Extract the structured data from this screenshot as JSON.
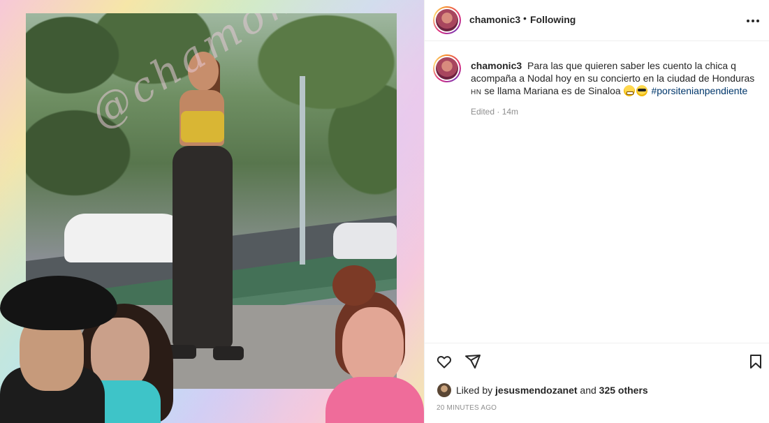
{
  "post": {
    "username": "chamonic3",
    "separator": "•",
    "follow_status": "Following",
    "caption": {
      "username": "chamonic3",
      "text_part1": "Para las que quieren saber les cuento la chica q acompaña a Nodal hoy en su concierto en la ciudad de Honduras",
      "flag": "HN",
      "text_part2": "se llama Mariana es de Sinaloa",
      "hashtag": "#porsitenianpendiente"
    },
    "edited": "Edited · 14m",
    "likes": {
      "prefix": "Liked by",
      "user": "jesusmendozanet",
      "and": "and",
      "others": "325 others"
    },
    "timestamp": "20 minutes ago"
  },
  "media": {
    "watermark": "@chamonic3"
  },
  "icons": {
    "more": "more-options-icon",
    "like": "heart-icon",
    "share": "send-icon",
    "save": "bookmark-icon",
    "emoji1": "grinning-emoji",
    "emoji2": "sunglasses-emoji"
  }
}
